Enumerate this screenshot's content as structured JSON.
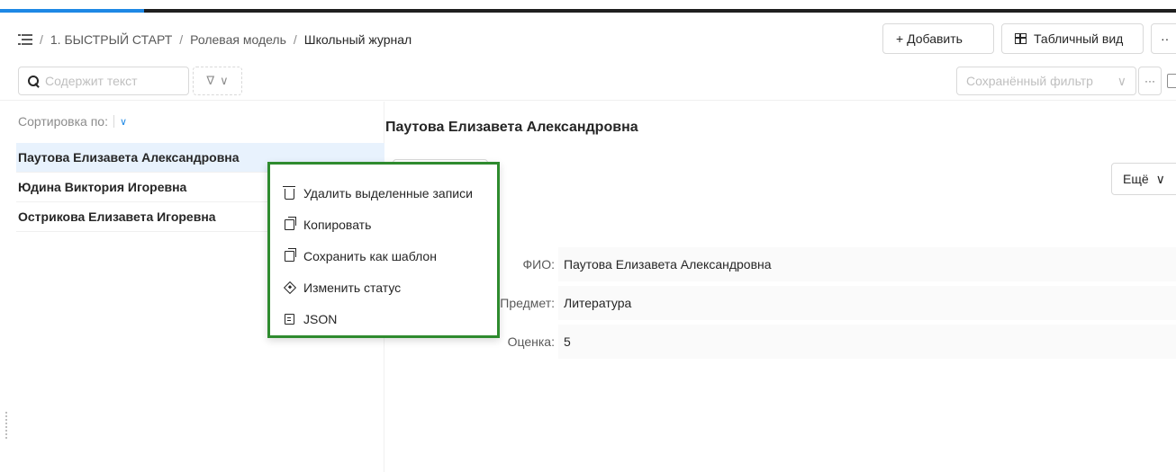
{
  "breadcrumb": {
    "separator": "/",
    "items": [
      "1. БЫСТРЫЙ СТАРТ",
      "Ролевая модель",
      "Школьный журнал"
    ]
  },
  "toolbar": {
    "add_label": "+ Добавить",
    "table_view_label": "Табличный вид",
    "more_label": "··"
  },
  "filter": {
    "search_placeholder": "Содержит текст",
    "filter_glyph": "∇",
    "chevron": "∨",
    "saved_filter_placeholder": "Сохранённый фильтр",
    "dots": "···"
  },
  "list": {
    "sort_label": "Сортировка по:",
    "sort_chevron": "∨",
    "items": [
      "Паутова Елизавета Александровна",
      "Юдина Виктория Игоревна",
      "Острикова Елизавета Игоревна"
    ]
  },
  "detail": {
    "title": "Паутова Елизавета Александровна",
    "more_label": "Ещё",
    "more_chevron": "∨",
    "fields": [
      {
        "label": "ФИО:",
        "value": "Паутова Елизавета Александровна"
      },
      {
        "label": "Предмет:",
        "value": "Литература"
      },
      {
        "label": "Оценка:",
        "value": "5"
      }
    ]
  },
  "context_menu": {
    "items": [
      {
        "label": "Удалить выделенные записи",
        "icon": "trash-icon"
      },
      {
        "label": "Копировать",
        "icon": "copy-icon"
      },
      {
        "label": "Сохранить как шаблон",
        "icon": "copy-icon"
      },
      {
        "label": "Изменить статус",
        "icon": "status-icon"
      },
      {
        "label": "JSON",
        "icon": "json-file-icon"
      }
    ]
  },
  "colors": {
    "accent": "#1e88e5",
    "selected_row": "#e8f2fd",
    "highlight_border": "#2e8b2e"
  }
}
